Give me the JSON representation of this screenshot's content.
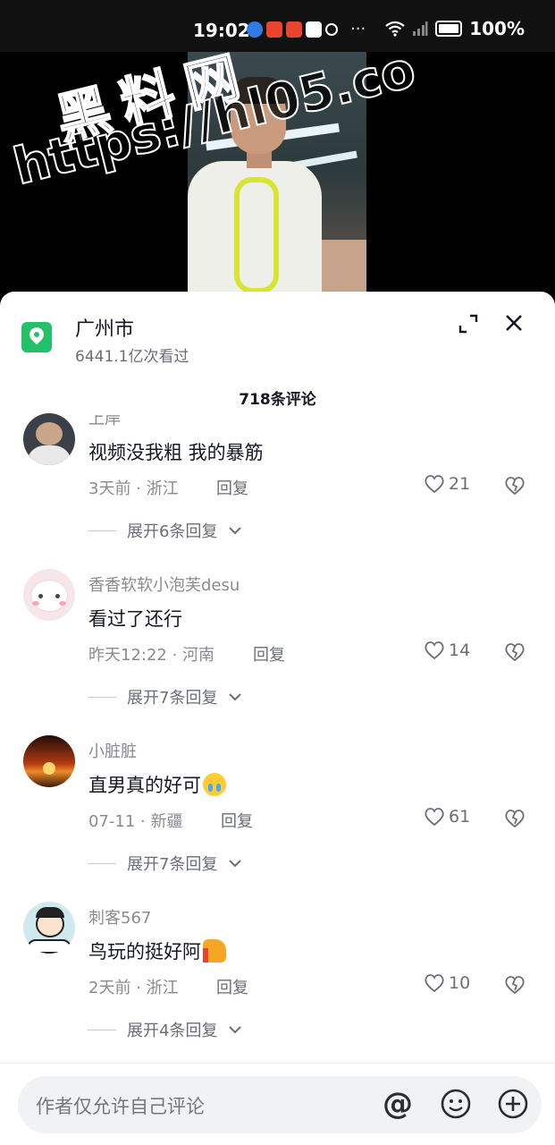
{
  "status_bar": {
    "time": "19:02",
    "battery": "100%",
    "more": "···"
  },
  "watermark": {
    "line1": "黑料网",
    "line2": "https://hl05.co"
  },
  "location": {
    "title": "广州市",
    "views": "6441.1亿次看过"
  },
  "comments_header": {
    "count_label": "718条评论"
  },
  "comments": [
    {
      "user": "上岸",
      "text": "视频没我粗  我的暴筋",
      "time": "3天前",
      "region": "浙江",
      "reply_label": "回复",
      "likes": "21",
      "expand_label": "展开6条回复",
      "avatar_color": "#3b3f48"
    },
    {
      "user": "香香软软小泡芙desu",
      "text": "看过了还行",
      "time": "昨天12:22",
      "region": "河南",
      "reply_label": "回复",
      "likes": "14",
      "expand_label": "展开7条回复",
      "avatar_color": "#f6e6ea"
    },
    {
      "user": "小脏脏",
      "text": "直男真的好可",
      "emoji": "crying-face-emoji",
      "time": "07-11",
      "region": "新疆",
      "reply_label": "回复",
      "likes": "61",
      "expand_label": "展开7条回复",
      "avatar_color": "#b33a12"
    },
    {
      "user": "刺客567",
      "text": "鸟玩的挺好阿",
      "emoji": "thumbs-up-emoji",
      "time": "2天前",
      "region": "浙江",
      "reply_label": "回复",
      "likes": "10",
      "expand_label": "展开4条回复",
      "avatar_color": "#cfe9ee"
    }
  ],
  "input": {
    "placeholder": "作者仅允许自己评论",
    "at_symbol": "@"
  },
  "colors": {
    "accent_green": "#25c06a",
    "text_primary": "#161823",
    "text_secondary": "#8a8b91"
  }
}
